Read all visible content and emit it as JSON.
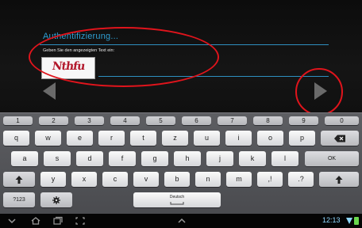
{
  "auth": {
    "title": "Authentifizierung...",
    "prompt": "Geben Sie den angezeigten Text ein:",
    "captcha_text": "Nthfu"
  },
  "keyboard": {
    "number_row": [
      "1",
      "2",
      "3",
      "4",
      "5",
      "6",
      "7",
      "8",
      "9",
      "0"
    ],
    "row1": [
      "q",
      "w",
      "e",
      "r",
      "t",
      "z",
      "u",
      "i",
      "o",
      "p"
    ],
    "row2": [
      "a",
      "s",
      "d",
      "f",
      "g",
      "h",
      "j",
      "k",
      "l"
    ],
    "row3": [
      "y",
      "x",
      "c",
      "v",
      "b",
      "n",
      "m",
      ",!",
      ".?"
    ],
    "ok_label": "OK",
    "symbols_label": "?123",
    "space_label": "Deutsch"
  },
  "status": {
    "time": "12:13",
    "battery_color": "#6ad84e",
    "accent_color": "#2e9dd0",
    "annotation_color": "#e0141c"
  }
}
